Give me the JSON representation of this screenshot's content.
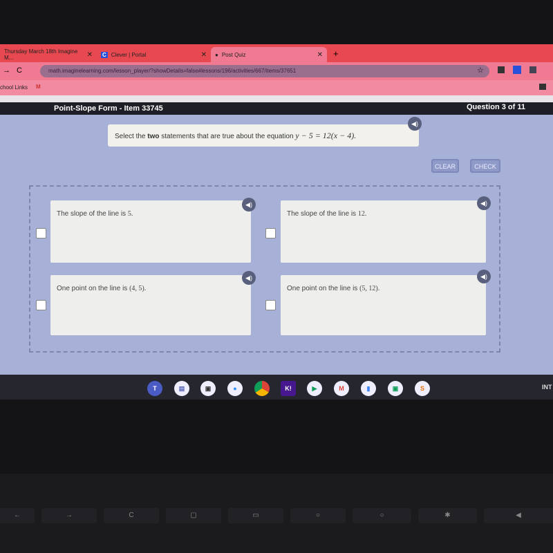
{
  "browser": {
    "tabs": [
      {
        "label": "Thursday March 18th Imagine M..."
      },
      {
        "label": "Clever | Portal",
        "icon": "clever-icon"
      },
      {
        "label": "Post Quiz",
        "active": true
      }
    ],
    "new_tab": "+",
    "url": "math.imaginelearning.com/lesson_player/?showDetails=false#lessons/196/activities/667/items/37651",
    "bookmarks": [
      "chool Links",
      "M"
    ]
  },
  "header": {
    "title": "Point-Slope Form - Item 33745",
    "progress": "Question 3 of 11"
  },
  "question": {
    "prefix": "Select the ",
    "bold": "two",
    "suffix": " statements that are true about the equation ",
    "equation": "y − 5 = 12(x − 4)."
  },
  "buttons": {
    "clear": "CLEAR",
    "check": "CHECK"
  },
  "options": [
    {
      "text": "The slope of the line is ",
      "math": "5.",
      "checked": false
    },
    {
      "text": "The slope of the line is ",
      "math": "12.",
      "checked": false
    },
    {
      "text": "One point on the line is ",
      "math": "(4, 5).",
      "checked": false
    },
    {
      "text": "One point on the line is ",
      "math": "(5, 12).",
      "checked": false
    }
  ],
  "shelf": {
    "apps": [
      "teams",
      "files",
      "drive-like",
      "zoom",
      "chrome",
      "K!",
      "play-store",
      "gmail",
      "docs",
      "classroom",
      "S"
    ],
    "status": "INT"
  },
  "colors": {
    "tabbar": "#e8484f",
    "header": "#1e1e26",
    "content": "#a7b0d6"
  }
}
